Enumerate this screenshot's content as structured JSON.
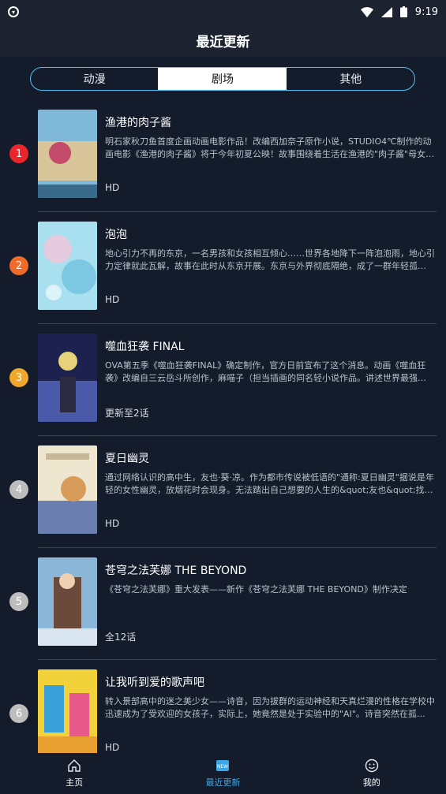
{
  "status": {
    "time": "9:19"
  },
  "appbar": {
    "title": "最近更新"
  },
  "tabs": [
    {
      "label": "动漫",
      "active": false
    },
    {
      "label": "剧场",
      "active": true
    },
    {
      "label": "其他",
      "active": false
    }
  ],
  "items": [
    {
      "rank": "1",
      "rank_color": "#e8262c",
      "title": "渔港的肉子酱",
      "desc": "明石家秋刀鱼首度企画动画电影作品！改编西加奈子原作小说，STUDIO4℃制作的动画电影《渔港的肉子酱》将于今年初夏公映！故事围绕着生活在渔港的\"肉子酱\"母女…",
      "status": "HD",
      "poster_colors": [
        "#7fb8d8",
        "#d8c59a",
        "#c44b6a"
      ]
    },
    {
      "rank": "2",
      "rank_color": "#f06a2a",
      "title": "泡泡",
      "desc": "地心引力不再的东京，一名男孩和女孩相互倾心……世界各地降下一阵泡泡雨，地心引力定律就此瓦解，故事在此时从东京开展。东京与外界彻底隔绝，成了一群年轻孤…",
      "status": "HD",
      "poster_colors": [
        "#a9e0ef",
        "#f3c6d8",
        "#5fb6d9"
      ]
    },
    {
      "rank": "3",
      "rank_color": "#f0a82a",
      "title": "噬血狂袭 FINAL",
      "desc": "OVA第五季《噬血狂袭FINAL》确定制作，官方日前宣布了这个消息。动画《噬血狂袭》改编自三云岳斗所创作，麻喵子（担当插画的同名轻小说作品。讲述世界最强…",
      "status": "更新至2话",
      "poster_colors": [
        "#1d2150",
        "#4a5aa8",
        "#e5d27a"
      ]
    },
    {
      "rank": "4",
      "rank_color": "#bdbdbd",
      "title": "夏日幽灵",
      "desc": "通过网络认识的高中生，友也·葵·凉。作为都市传说被低语的\"通称:夏日幽灵\"据说是年轻的女性幽灵，放烟花时会现身。无法踏出自己想要的人生的&quot;友也&quot;找…",
      "status": "HD",
      "poster_colors": [
        "#efe6cf",
        "#d89c5a",
        "#6a7fb0"
      ]
    },
    {
      "rank": "5",
      "rank_color": "#bdbdbd",
      "title": "苍穹之法芙娜 THE BEYOND",
      "desc": "《苍穹之法芙娜》重大发表——新作《苍穹之法芙娜 THE BEYOND》制作决定",
      "status": "全12话",
      "poster_colors": [
        "#8ab6d8",
        "#6a4a3a",
        "#d9e6f0"
      ]
    },
    {
      "rank": "6",
      "rank_color": "#bdbdbd",
      "title": "让我听到爱的歌声吧",
      "desc": "转入景部高中的迷之美少女——诗音，因为拔群的运动神经和天真烂漫的性格在学校中迅速成为了受欢迎的女孩子，实际上，她竟然是处于实验中的\"AI\"。诗音突然在孤…",
      "status": "HD",
      "poster_colors": [
        "#f2d23a",
        "#3aa0d8",
        "#e85a8a"
      ]
    }
  ],
  "bottom_nav": [
    {
      "label": "主页",
      "icon": "home-icon",
      "active": false
    },
    {
      "label": "最近更新",
      "icon": "new-icon",
      "active": true
    },
    {
      "label": "我的",
      "icon": "profile-icon",
      "active": false
    }
  ]
}
